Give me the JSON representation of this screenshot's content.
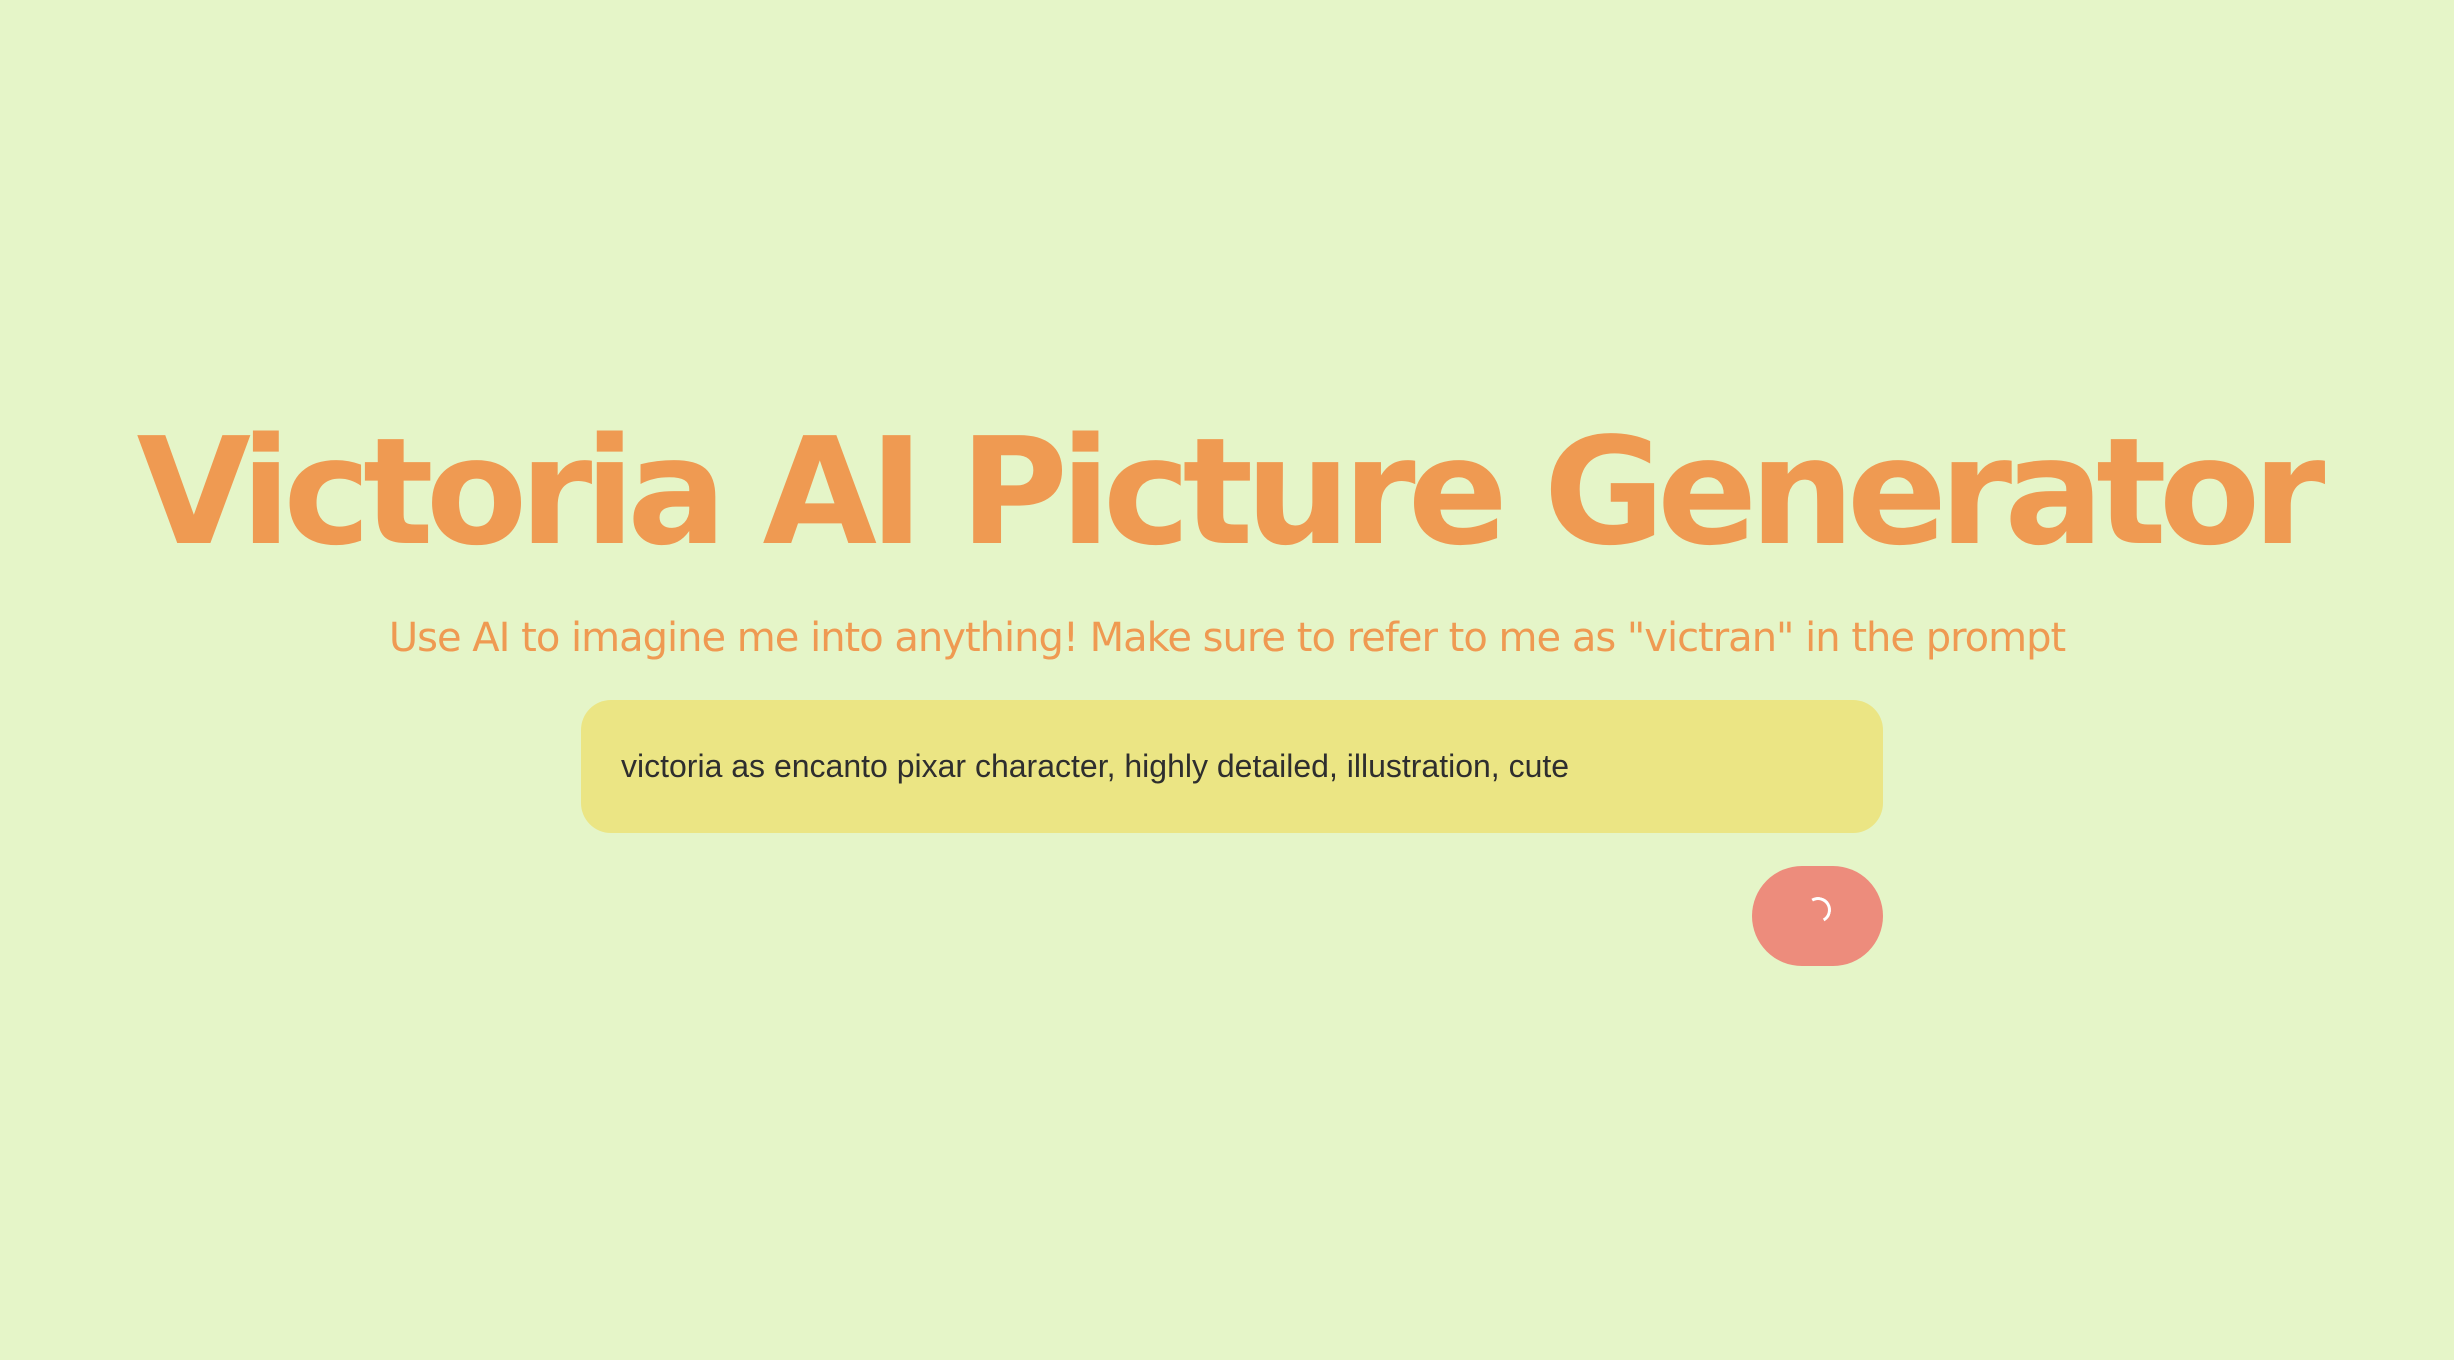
{
  "header": {
    "title": "Victoria AI Picture Generator",
    "subtitle": "Use AI to imagine me into anything! Make sure to refer to me as \"victran\" in the prompt"
  },
  "prompt": {
    "value": "victoria as encanto pixar character, highly detailed, illustration, cute"
  },
  "generate_button": {
    "icon": "spinner-icon",
    "state": "loading"
  },
  "colors": {
    "background": "#e5f5c8",
    "title": "#ef9a52",
    "input_background": "#ebe584",
    "button": "#ed8c7c"
  }
}
